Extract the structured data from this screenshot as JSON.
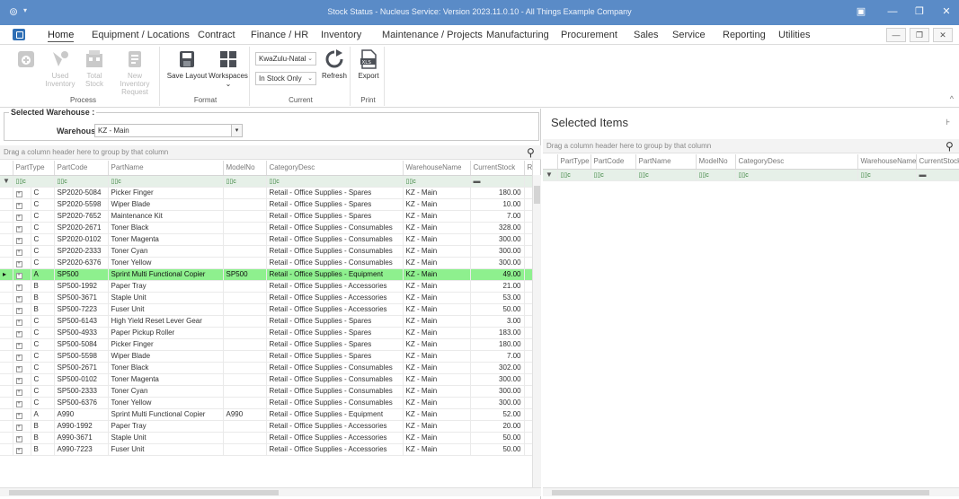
{
  "window": {
    "title": "Stock Status - Nucleus Service: Version 2023.11.0.10 - All Things Example Company",
    "controls": [
      "▣",
      "—",
      "❐",
      "✕"
    ]
  },
  "menu": {
    "items": [
      "Home",
      "Equipment / Locations",
      "Contract",
      "Finance / HR",
      "Inventory",
      "Maintenance / Projects",
      "Manufacturing",
      "Procurement",
      "Sales",
      "Service",
      "Reporting",
      "Utilities"
    ],
    "mdi": [
      "—",
      "❐",
      "✕"
    ]
  },
  "ribbon": {
    "process": {
      "label": "Process",
      "buttons": [
        "",
        "Used Inventory",
        "Total Stock",
        "New Inventory Request"
      ]
    },
    "format": {
      "label": "Format",
      "save_layout": "Save Layout",
      "workspaces": "Workspaces"
    },
    "current": {
      "label": "Current",
      "region": "KwaZulu-Natal",
      "filter": "In Stock Only",
      "refresh": "Refresh"
    },
    "print": {
      "label": "Print",
      "export": "Export"
    }
  },
  "warehouse": {
    "legend": "Selected Warehouse :",
    "label": "Warehouse",
    "value": "KZ - Main"
  },
  "grid": {
    "group_hint": "Drag a column header here to group by that column",
    "columns": [
      "PartType",
      "PartCode",
      "PartName",
      "ModelNo",
      "CategoryDesc",
      "WarehouseName",
      "CurrentStock",
      "Re"
    ],
    "filter_symbol": "▯▯c",
    "rows": [
      {
        "type": "C",
        "code": "SP2020-5084",
        "name": "Picker Finger",
        "model": "",
        "cat": "Retail - Office Supplies - Spares",
        "wh": "KZ - Main",
        "stock": "180.00"
      },
      {
        "type": "C",
        "code": "SP2020-5598",
        "name": "Wiper Blade",
        "model": "",
        "cat": "Retail - Office Supplies - Spares",
        "wh": "KZ - Main",
        "stock": "10.00"
      },
      {
        "type": "C",
        "code": "SP2020-7652",
        "name": "Maintenance Kit",
        "model": "",
        "cat": "Retail - Office Supplies - Spares",
        "wh": "KZ - Main",
        "stock": "7.00"
      },
      {
        "type": "C",
        "code": "SP2020-2671",
        "name": "Toner Black",
        "model": "",
        "cat": "Retail - Office Supplies - Consumables",
        "wh": "KZ - Main",
        "stock": "328.00"
      },
      {
        "type": "C",
        "code": "SP2020-0102",
        "name": "Toner Magenta",
        "model": "",
        "cat": "Retail - Office Supplies - Consumables",
        "wh": "KZ - Main",
        "stock": "300.00"
      },
      {
        "type": "C",
        "code": "SP2020-2333",
        "name": "Toner Cyan",
        "model": "",
        "cat": "Retail - Office Supplies - Consumables",
        "wh": "KZ - Main",
        "stock": "300.00"
      },
      {
        "type": "C",
        "code": "SP2020-6376",
        "name": "Toner Yellow",
        "model": "",
        "cat": "Retail - Office Supplies - Consumables",
        "wh": "KZ - Main",
        "stock": "300.00"
      },
      {
        "type": "A",
        "code": "SP500",
        "name": "Sprint Multi Functional Copier",
        "model": "SP500",
        "cat": "Retail - Office Supplies - Equipment",
        "wh": "KZ - Main",
        "stock": "49.00",
        "selected": true
      },
      {
        "type": "B",
        "code": "SP500-1992",
        "name": "Paper Tray",
        "model": "",
        "cat": "Retail - Office Supplies - Accessories",
        "wh": "KZ - Main",
        "stock": "21.00"
      },
      {
        "type": "B",
        "code": "SP500-3671",
        "name": "Staple Unit",
        "model": "",
        "cat": "Retail - Office Supplies - Accessories",
        "wh": "KZ - Main",
        "stock": "53.00"
      },
      {
        "type": "B",
        "code": "SP500-7223",
        "name": "Fuser Unit",
        "model": "",
        "cat": "Retail - Office Supplies - Accessories",
        "wh": "KZ - Main",
        "stock": "50.00"
      },
      {
        "type": "C",
        "code": "SP500-6143",
        "name": "High Yield Reset Lever Gear",
        "model": "",
        "cat": "Retail - Office Supplies - Spares",
        "wh": "KZ - Main",
        "stock": "3.00"
      },
      {
        "type": "C",
        "code": "SP500-4933",
        "name": "Paper Pickup Roller",
        "model": "",
        "cat": "Retail - Office Supplies - Spares",
        "wh": "KZ - Main",
        "stock": "183.00"
      },
      {
        "type": "C",
        "code": "SP500-5084",
        "name": "Picker Finger",
        "model": "",
        "cat": "Retail - Office Supplies - Spares",
        "wh": "KZ - Main",
        "stock": "180.00"
      },
      {
        "type": "C",
        "code": "SP500-5598",
        "name": "Wiper Blade",
        "model": "",
        "cat": "Retail - Office Supplies - Spares",
        "wh": "KZ - Main",
        "stock": "7.00"
      },
      {
        "type": "C",
        "code": "SP500-2671",
        "name": "Toner Black",
        "model": "",
        "cat": "Retail - Office Supplies - Consumables",
        "wh": "KZ - Main",
        "stock": "302.00"
      },
      {
        "type": "C",
        "code": "SP500-0102",
        "name": "Toner Magenta",
        "model": "",
        "cat": "Retail - Office Supplies - Consumables",
        "wh": "KZ - Main",
        "stock": "300.00"
      },
      {
        "type": "C",
        "code": "SP500-2333",
        "name": "Toner Cyan",
        "model": "",
        "cat": "Retail - Office Supplies - Consumables",
        "wh": "KZ - Main",
        "stock": "300.00"
      },
      {
        "type": "C",
        "code": "SP500-6376",
        "name": "Toner Yellow",
        "model": "",
        "cat": "Retail - Office Supplies - Consumables",
        "wh": "KZ - Main",
        "stock": "300.00"
      },
      {
        "type": "A",
        "code": "A990",
        "name": "Sprint Multi Functional Copier",
        "model": "A990",
        "cat": "Retail - Office Supplies - Equipment",
        "wh": "KZ - Main",
        "stock": "52.00"
      },
      {
        "type": "B",
        "code": "A990-1992",
        "name": "Paper Tray",
        "model": "",
        "cat": "Retail - Office Supplies - Accessories",
        "wh": "KZ - Main",
        "stock": "20.00"
      },
      {
        "type": "B",
        "code": "A990-3671",
        "name": "Staple Unit",
        "model": "",
        "cat": "Retail - Office Supplies - Accessories",
        "wh": "KZ - Main",
        "stock": "50.00"
      },
      {
        "type": "B",
        "code": "A990-7223",
        "name": "Fuser Unit",
        "model": "",
        "cat": "Retail - Office Supplies - Accessories",
        "wh": "KZ - Main",
        "stock": "50.00"
      }
    ]
  },
  "selected_items": {
    "title": "Selected Items",
    "group_hint": "Drag a column header here to group by that column",
    "columns": [
      "PartType",
      "PartCode",
      "PartName",
      "ModelNo",
      "CategoryDesc",
      "WarehouseName",
      "CurrentStock"
    ]
  },
  "colors": {
    "titlebar": "#5a8bc7",
    "selected_row": "#8ef08e",
    "filter_row": "#e6f0e8"
  }
}
